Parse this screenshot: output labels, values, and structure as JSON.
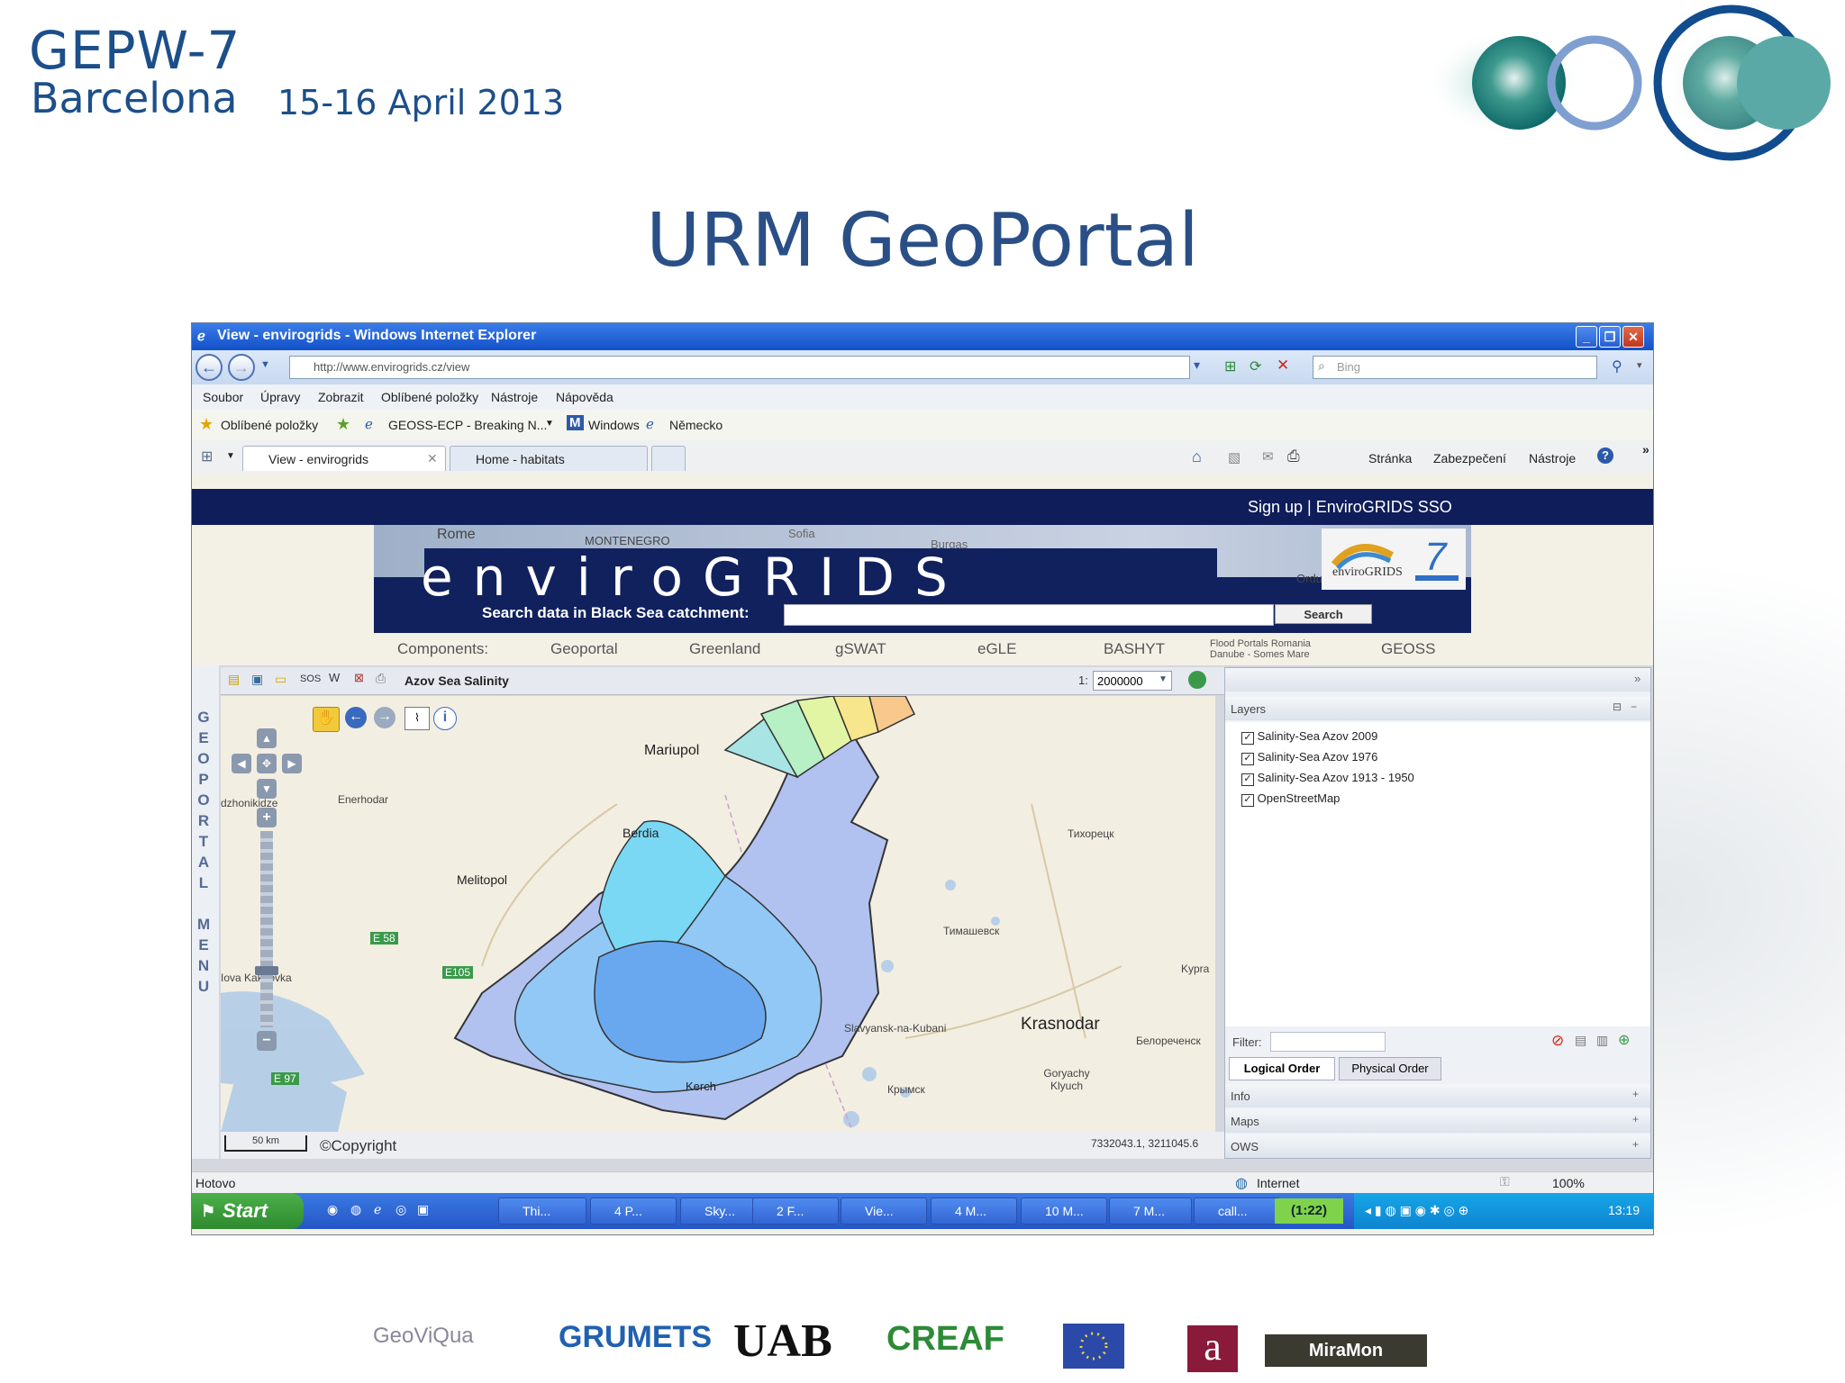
{
  "slide": {
    "conference": "GEPW-7",
    "city": "Barcelona",
    "date": "15-16 April 2013",
    "title": "URM GeoPortal"
  },
  "browser": {
    "title": "View - envirogrids - Windows Internet Explorer",
    "url": "http://www.envirogrids.cz/view",
    "search_placeholder": "Bing",
    "menu": [
      "Soubor",
      "Úpravy",
      "Zobrazit",
      "Oblíbené položky",
      "Nástroje",
      "Nápověda"
    ],
    "favorites_label": "Oblíbené položky",
    "favorites": [
      "GEOSS-ECP - Breaking N...",
      "Windows",
      "Německo"
    ],
    "tabs": [
      "View - envirogrids",
      "Home - habitats"
    ],
    "command_bar": [
      "Stránka",
      "Zabezpečení",
      "Nástroje"
    ],
    "status": "Hotovo",
    "zone": "Internet",
    "zoom": "100%"
  },
  "page": {
    "signup": "Sign up | EnviroGRIDS SSO",
    "logo": "enviroGRIDS",
    "search_label": "Search data in Black Sea catchment:",
    "search_button": "Search",
    "components_label": "Components:",
    "components": [
      "Geoportal",
      "Greenland",
      "gSWAT",
      "eGLE",
      "BASHYT",
      "GEOSS"
    ],
    "flood_portal_line1": "Flood Portals Romania",
    "flood_portal_line2": "Danube - Somes Mare"
  },
  "geoportal": {
    "side_menu": [
      "G",
      "E",
      "O",
      "P",
      "O",
      "R",
      "T",
      "A",
      "L",
      "",
      "M",
      "E",
      "N",
      "U"
    ],
    "map_title": "Azov Sea Salinity",
    "toolbar_text": "SOS",
    "scale_prefix": "1:",
    "scale_value": "2000000",
    "scale_bar": "50 km",
    "copyright": "©Copyright",
    "coordinates": "7332043.1, 3211045.6",
    "map_labels": [
      "Mariupol",
      "Berdia",
      "Melitopol",
      "Enerhodar",
      "E 58",
      "E105",
      "E 97",
      "Kerch",
      "Slavyansk-na-Kubani",
      "Krasnodar",
      "Тихорецк",
      "Тимашевск",
      "Kypra",
      "Крымск",
      "Goryachy Klyuch",
      "Белореченск",
      "dzhonikidze",
      "Iova Kakhovka"
    ],
    "panel": {
      "layers_title": "Layers",
      "layers": [
        "Salinity-Sea Azov 2009",
        "Salinity-Sea Azov 1976",
        "Salinity-Sea Azov 1913 - 1950",
        "OpenStreetMap"
      ],
      "filter_label": "Filter:",
      "order_tabs": [
        "Logical Order",
        "Physical Order"
      ],
      "sections": [
        "Info",
        "Maps",
        "OWS"
      ]
    }
  },
  "taskbar": {
    "start": "Start",
    "items": [
      "Thi...",
      "4 P...",
      "Sky...",
      "2 F...",
      "Vie...",
      "4 M...",
      "10 M...",
      "7 M...",
      "call..."
    ],
    "counter": "(1:22)",
    "clock": "13:19"
  },
  "sponsors": [
    "GeoViQua",
    "GRUMETS",
    "UAB",
    "CREAF",
    "MiraMon"
  ],
  "colors": {
    "slide_blue": "#2a4f86",
    "ie_title_blue": "#1f5fd6",
    "envirogrids_navy": "#10215e",
    "xp_green": "#3a9d3a"
  }
}
